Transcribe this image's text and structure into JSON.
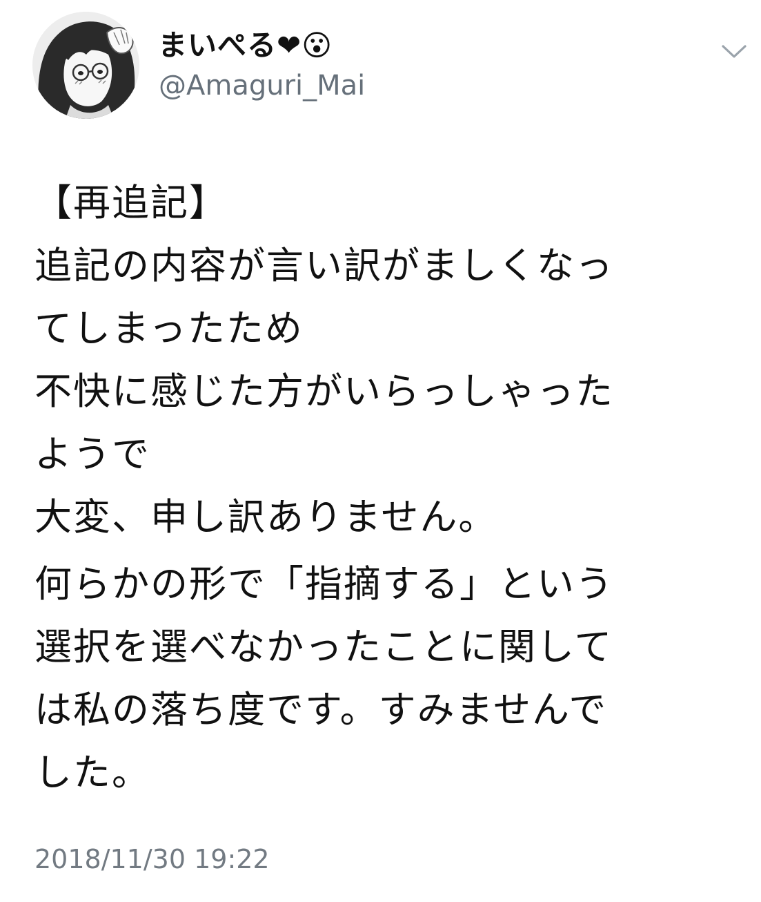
{
  "tweet": {
    "display_name": "まいぺる❤︎😮",
    "handle": "@Amaguri_Mai",
    "menu_icon": "chevron-down-icon",
    "avatar_icon": "avatar-manga-portrait",
    "paragraphs": [
      {
        "lines": [
          "【再追記】",
          "追記の内容が言い訳がましくなっ",
          "てしまったため",
          "不快に感じた方がいらっしゃった",
          "ようで",
          "大変、申し訳ありません。"
        ]
      },
      {
        "lines": [
          "何らかの形で「指摘する」という",
          "選択を選べなかったことに関して",
          "は私の落ち度です。すみませんで",
          "した。"
        ]
      }
    ],
    "timestamp": "2018/11/30 19:22"
  },
  "colors": {
    "text": "#111111",
    "secondary_text": "#66707a",
    "background": "#ffffff",
    "chevron": "#9aa3ab"
  }
}
